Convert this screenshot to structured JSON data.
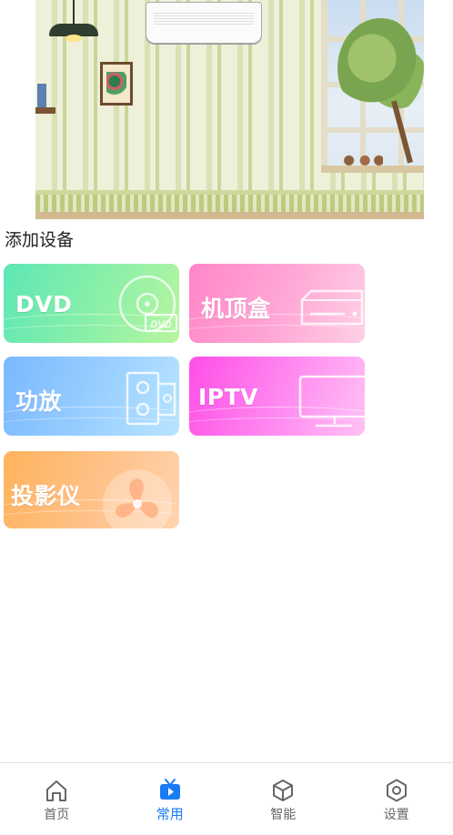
{
  "section": {
    "title": "添加设备"
  },
  "devices": [
    {
      "id": "dvd",
      "label": "DVD",
      "icon": "disc-icon"
    },
    {
      "id": "stb",
      "label": "机顶盒",
      "icon": "set-top-box-icon"
    },
    {
      "id": "amp",
      "label": "功放",
      "icon": "speaker-icon"
    },
    {
      "id": "iptv",
      "label": "IPTV",
      "icon": "monitor-icon"
    },
    {
      "id": "projector",
      "label": "投影仪",
      "icon": "fan-icon"
    }
  ],
  "tabbar": {
    "items": [
      {
        "label": "首页",
        "icon": "home-icon",
        "active": false
      },
      {
        "label": "常用",
        "icon": "tv-play-icon",
        "active": true
      },
      {
        "label": "智能",
        "icon": "cube-icon",
        "active": false
      },
      {
        "label": "设置",
        "icon": "hexagon-settings-icon",
        "active": false
      }
    ]
  },
  "colors": {
    "accent": "#1a7cf5",
    "inactive_tab": "#666666",
    "dvd_card": "#5ee7b5",
    "stb_card": "#ff86c8",
    "amp_card": "#7ab8ff",
    "iptv_card": "#ff4ee6",
    "projector_card": "#ffb35c"
  }
}
